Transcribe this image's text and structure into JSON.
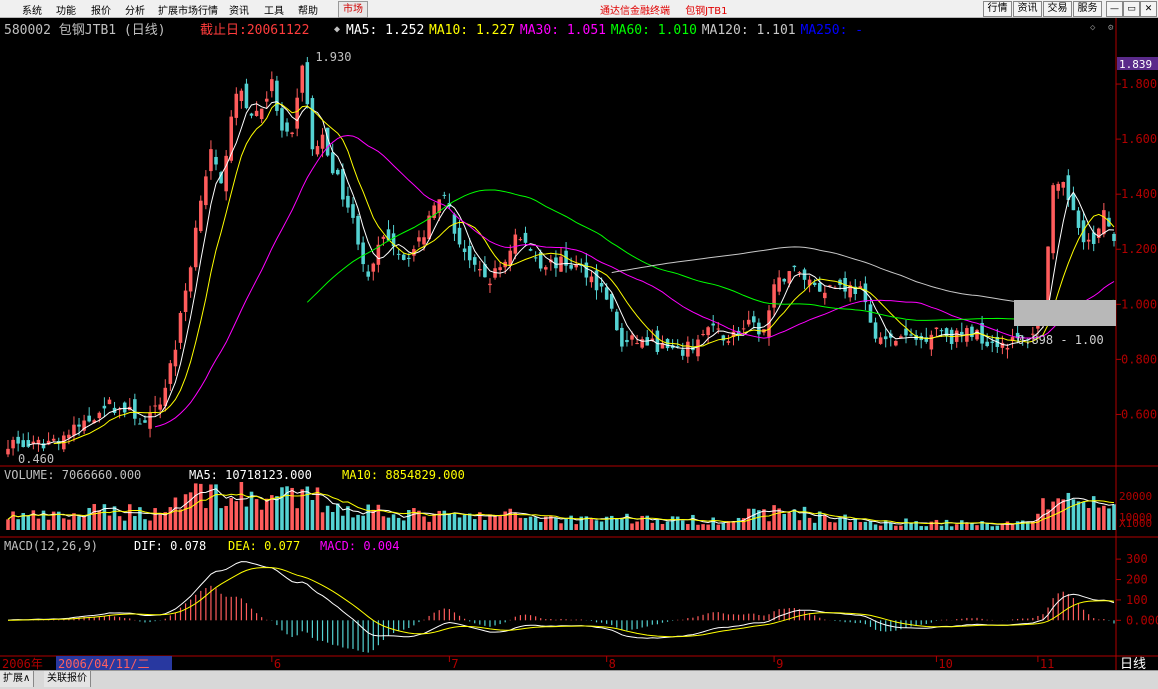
{
  "menu": {
    "items": [
      "系统",
      "功能",
      "报价",
      "分析",
      "扩展市场行情",
      "资讯",
      "工具",
      "帮助"
    ],
    "market_tab": "市场",
    "app_title": "通达信金融终端",
    "stock_title": "包钢JTB1",
    "right_buttons": [
      "行情",
      "资讯",
      "交易",
      "服务"
    ],
    "window_buttons": [
      "—",
      "▭",
      "✕"
    ]
  },
  "price_panel": {
    "code_name": "580002 包钢JTB1 (日线)",
    "date_label": "截止日:20061122",
    "ma": [
      {
        "label": "MA5: 1.252",
        "color": "#ffffff"
      },
      {
        "label": "MA10: 1.227",
        "color": "#ffff00"
      },
      {
        "label": "MA30: 1.051",
        "color": "#ff00ff"
      },
      {
        "label": "MA60: 1.010",
        "color": "#00ff00"
      },
      {
        "label": "MA120: 1.101",
        "color": "#c8c8c8"
      },
      {
        "label": "MA250: -",
        "color": "#0000ff"
      }
    ],
    "high_label": "1.930",
    "low_label": "0.460",
    "current_price_label": "1.839",
    "tooltip_label": "0.898 - 1.00",
    "y_ticks": [
      "1.800",
      "1.600",
      "1.400",
      "1.200",
      "1.000",
      "0.800",
      "0.600"
    ],
    "y_range": [
      0.42,
      1.96
    ]
  },
  "volume_panel": {
    "label_volume": "VOLUME: 7066660.000",
    "label_ma5": "MA5: 10718123.000",
    "label_ma10": "MA10: 8854829.000",
    "y_ticks": [
      "20000",
      "10000"
    ],
    "unit": "X1000"
  },
  "macd_panel": {
    "label_params": "MACD(12,26,9)",
    "label_dif": "DIF: 0.078",
    "label_dea": "DEA: 0.077",
    "label_macd": "MACD: 0.004",
    "y_ticks": [
      "300",
      "200",
      "100",
      "0.000"
    ],
    "y_range": [
      -0.17,
      0.33
    ]
  },
  "time_axis": {
    "start_label": "2006年",
    "cursor_label": "2006/04/11/二",
    "months": [
      {
        "label": "6",
        "index": 52
      },
      {
        "label": "7",
        "index": 87
      },
      {
        "label": "8",
        "index": 118
      },
      {
        "label": "9",
        "index": 151
      },
      {
        "label": "10",
        "index": 183
      },
      {
        "label": "11",
        "index": 203
      }
    ],
    "period": "日线"
  },
  "status_bar": {
    "tabs": [
      "扩展∧",
      "关联报价"
    ]
  },
  "colors": {
    "up": "#ff5c5c",
    "down": "#54d2d2",
    "axis": "#b00000",
    "label_white": "#c0c0c0",
    "label_red": "#ff3c3c",
    "label_purple": "#ff00ff"
  },
  "chart_data": {
    "type": "candlestick",
    "x_count": 219,
    "close_keypoints": [
      [
        0,
        0.5
      ],
      [
        5,
        0.48
      ],
      [
        12,
        0.53
      ],
      [
        16,
        0.58
      ],
      [
        19,
        0.64
      ],
      [
        22,
        0.62
      ],
      [
        25,
        0.6
      ],
      [
        27,
        0.56
      ],
      [
        30,
        0.64
      ],
      [
        33,
        0.85
      ],
      [
        36,
        1.15
      ],
      [
        38,
        1.4
      ],
      [
        40,
        1.55
      ],
      [
        42,
        1.42
      ],
      [
        44,
        1.7
      ],
      [
        46,
        1.78
      ],
      [
        48,
        1.68
      ],
      [
        50,
        1.72
      ],
      [
        52,
        1.8
      ],
      [
        54,
        1.62
      ],
      [
        56,
        1.6
      ],
      [
        58,
        1.88
      ],
      [
        60,
        1.56
      ],
      [
        62,
        1.6
      ],
      [
        65,
        1.45
      ],
      [
        67,
        1.36
      ],
      [
        69,
        1.24
      ],
      [
        71,
        1.08
      ],
      [
        73,
        1.2
      ],
      [
        75,
        1.25
      ],
      [
        78,
        1.17
      ],
      [
        80,
        1.2
      ],
      [
        82,
        1.26
      ],
      [
        84,
        1.38
      ],
      [
        86,
        1.42
      ],
      [
        88,
        1.26
      ],
      [
        90,
        1.2
      ],
      [
        92,
        1.12
      ],
      [
        95,
        1.09
      ],
      [
        98,
        1.16
      ],
      [
        100,
        1.25
      ],
      [
        103,
        1.2
      ],
      [
        105,
        1.15
      ],
      [
        110,
        1.15
      ],
      [
        114,
        1.12
      ],
      [
        118,
        1.03
      ],
      [
        121,
        0.85
      ],
      [
        124,
        0.87
      ],
      [
        128,
        0.85
      ],
      [
        132,
        0.82
      ],
      [
        135,
        0.85
      ],
      [
        138,
        0.91
      ],
      [
        142,
        0.88
      ],
      [
        146,
        0.92
      ],
      [
        149,
        0.9
      ],
      [
        151,
        1.05
      ],
      [
        154,
        1.13
      ],
      [
        157,
        1.1
      ],
      [
        160,
        1.06
      ],
      [
        164,
        1.07
      ],
      [
        168,
        1.05
      ],
      [
        170,
        0.92
      ],
      [
        173,
        0.86
      ],
      [
        176,
        0.88
      ],
      [
        180,
        0.87
      ],
      [
        183,
        0.92
      ],
      [
        186,
        0.88
      ],
      [
        190,
        0.9
      ],
      [
        193,
        0.87
      ],
      [
        196,
        0.86
      ],
      [
        200,
        0.87
      ],
      [
        202,
        0.9
      ],
      [
        204,
        1.0
      ],
      [
        206,
        1.41
      ],
      [
        208,
        1.42
      ],
      [
        210,
        1.35
      ],
      [
        212,
        1.25
      ],
      [
        214,
        1.21
      ],
      [
        216,
        1.32
      ],
      [
        218,
        1.25
      ]
    ],
    "volume_keypoints": [
      [
        0,
        0.35
      ],
      [
        10,
        0.3
      ],
      [
        20,
        0.45
      ],
      [
        30,
        0.4
      ],
      [
        35,
        0.85
      ],
      [
        40,
        0.9
      ],
      [
        45,
        0.75
      ],
      [
        50,
        0.8
      ],
      [
        55,
        0.7
      ],
      [
        60,
        0.75
      ],
      [
        65,
        0.55
      ],
      [
        70,
        0.45
      ],
      [
        75,
        0.5
      ],
      [
        80,
        0.35
      ],
      [
        90,
        0.3
      ],
      [
        100,
        0.35
      ],
      [
        110,
        0.25
      ],
      [
        120,
        0.3
      ],
      [
        130,
        0.22
      ],
      [
        140,
        0.25
      ],
      [
        150,
        0.4
      ],
      [
        155,
        0.45
      ],
      [
        160,
        0.3
      ],
      [
        170,
        0.2
      ],
      [
        180,
        0.18
      ],
      [
        190,
        0.15
      ],
      [
        200,
        0.18
      ],
      [
        204,
        0.5
      ],
      [
        206,
        0.85
      ],
      [
        210,
        0.7
      ],
      [
        214,
        0.6
      ],
      [
        218,
        0.5
      ]
    ],
    "seed": 7
  }
}
